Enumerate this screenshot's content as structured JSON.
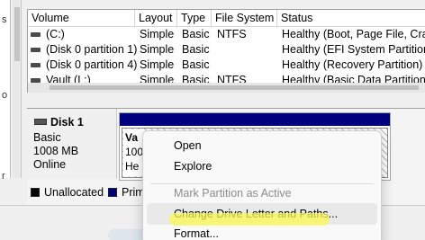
{
  "columns": [
    "Volume",
    "Layout",
    "Type",
    "File System",
    "Status"
  ],
  "rows": [
    {
      "volume": "(C:)",
      "layout": "Simple",
      "type": "Basic",
      "fs": "NTFS",
      "status": "Healthy (Boot, Page File, Crash"
    },
    {
      "volume": "(Disk 0 partition 1)",
      "layout": "Simple",
      "type": "Basic",
      "fs": "",
      "status": "Healthy (EFI System Partition)"
    },
    {
      "volume": "(Disk 0 partition 4)",
      "layout": "Simple",
      "type": "Basic",
      "fs": "",
      "status": "Healthy (Recovery Partition)"
    },
    {
      "volume": "Vault (L:)",
      "layout": "Simple",
      "type": "Basic",
      "fs": "NTFS",
      "status": "Healthy (Basic Data Partition)"
    }
  ],
  "left_pane": {
    "chars": [
      "s",
      "o",
      "r"
    ]
  },
  "disk": {
    "name": "Disk 1",
    "type": "Basic",
    "size": "1008 MB",
    "state": "Online"
  },
  "partition": {
    "name": "Va",
    "size": "100",
    "status": "He"
  },
  "legend": [
    {
      "label": "Unallocated",
      "color": "#000000"
    },
    {
      "label": "Prim",
      "color": "#00007f"
    }
  ],
  "menu": {
    "items": [
      {
        "label": "Open",
        "enabled": true
      },
      {
        "label": "Explore",
        "enabled": true
      },
      {
        "label": "Mark Partition as Active",
        "enabled": false
      },
      {
        "label": "Change Drive Letter and Paths...",
        "enabled": true,
        "highlighted": true
      },
      {
        "label": "Format...",
        "enabled": true
      }
    ]
  },
  "colors": {
    "primary_partition": "#00007f",
    "highlight": "#faf850"
  }
}
